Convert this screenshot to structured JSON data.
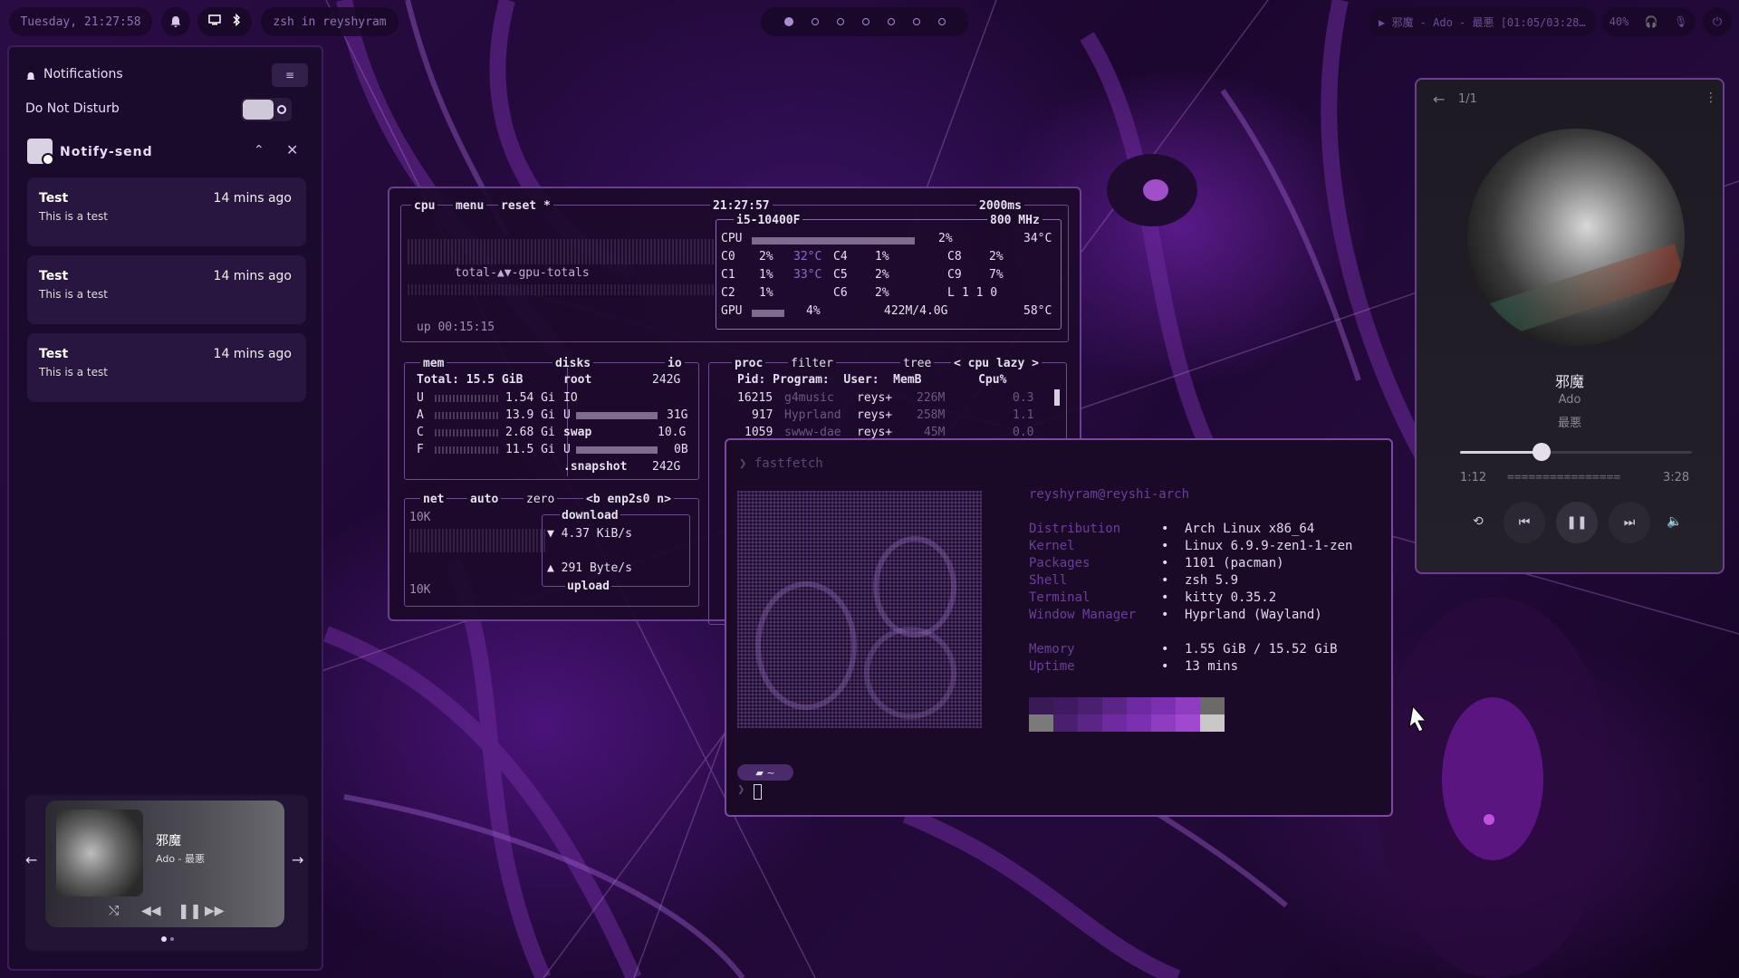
{
  "topbar": {
    "clock": "Tuesday, 21:27:58",
    "window_title": "zsh in reyshyram",
    "workspaces": [
      true,
      false,
      false,
      false,
      false,
      false,
      false
    ],
    "media_text": "▶ 邪魔 - Ado - 最悪 [01:05/03:28…",
    "volume": "40%"
  },
  "notifications": {
    "header": "Notifications",
    "dnd_label": "Do Not Disturb",
    "group_app": "Notify-send",
    "items": [
      {
        "title": "Test",
        "body": "This is a test",
        "time": "14 mins ago"
      },
      {
        "title": "Test",
        "body": "This is a test",
        "time": "14 mins ago"
      },
      {
        "title": "Test",
        "body": "This is a test",
        "time": "14 mins ago"
      }
    ],
    "mini_player": {
      "title": "邪魔",
      "artist": "Ado - 最悪"
    }
  },
  "btop": {
    "cpu_tabs": [
      "cpu",
      "menu",
      "reset *"
    ],
    "time": "21:27:57",
    "interval": "2000ms",
    "graph_label": "total-▲▼-gpu-totals",
    "uptime": "up 00:15:15",
    "cpu_name": "i5-10400F",
    "cpu_freq": "800 MHz",
    "cpu_rows": [
      {
        "l": "CPU",
        "p": "2%",
        "t": "34°C"
      },
      {
        "l": "C0",
        "p": "2%",
        "t": "32°C"
      },
      {
        "l": "C1",
        "p": "1%",
        "t": "33°C"
      },
      {
        "l": "C2",
        "p": "1%",
        "t": ""
      }
    ],
    "cpu_rows2": [
      {
        "l": "C4",
        "p": "1%"
      },
      {
        "l": "C5",
        "p": "2%"
      },
      {
        "l": "C6",
        "p": "2%"
      }
    ],
    "cpu_rows3": [
      {
        "l": "C8",
        "p": "2%"
      },
      {
        "l": "C9",
        "p": "7%"
      },
      {
        "l": "L",
        "p": "1 1 0"
      }
    ],
    "gpu": {
      "l": "GPU",
      "p": "4%",
      "mem": "422M/4.0G",
      "t": "58°C"
    },
    "mem": {
      "title": "mem",
      "total": "Total: 15.5 GiB",
      "rows": [
        {
          "l": "U",
          "v": "1.54 Gi"
        },
        {
          "l": "A",
          "v": "13.9 Gi"
        },
        {
          "l": "C",
          "v": "2.68 Gi"
        },
        {
          "l": "F",
          "v": "11.5 Gi"
        }
      ]
    },
    "disks": {
      "title": "disks",
      "io": "io",
      "root": "root",
      "root_size": "242G",
      "io_label": "IO",
      "u1": "31G",
      "swap": "swap",
      "swap_size": "10.G",
      "u2": "0B",
      "snap": ".snapshot",
      "snap_size": "242G"
    },
    "proc": {
      "tabs": [
        "proc",
        "filter",
        "tree",
        "< cpu lazy >"
      ],
      "headers": "Pid: Program:  User:  MemB        Cpu%",
      "rows": [
        {
          "pid": "16215",
          "prog": "g4music",
          "user": "reys+",
          "mem": "226M",
          "cpu": "0.3"
        },
        {
          "pid": "917",
          "prog": "Hyprland",
          "user": "reys+",
          "mem": "258M",
          "cpu": "1.1"
        },
        {
          "pid": "1059",
          "prog": "swww-dae",
          "user": "reys+",
          "mem": "45M",
          "cpu": "0.0"
        }
      ]
    },
    "net": {
      "tabs": [
        "net",
        "auto",
        "zero",
        "<b enp2s0 n>"
      ],
      "scale_top": "10K",
      "scale_bottom": "10K",
      "download_label": "download",
      "download": "▼ 4.37 KiB/s",
      "upload": "▲ 291 Byte/s",
      "upload_label": "upload"
    }
  },
  "fastfetch": {
    "command": "fastfetch",
    "user_host": "reyshyram@reyshi-arch",
    "info": [
      {
        "k": "Distribution",
        "v": "Arch Linux x86_64"
      },
      {
        "k": "Kernel",
        "v": "Linux 6.9.9-zen1-1-zen"
      },
      {
        "k": "Packages",
        "v": "1101 (pacman)"
      },
      {
        "k": "Shell",
        "v": "zsh 5.9"
      },
      {
        "k": "Terminal",
        "v": "kitty 0.35.2"
      },
      {
        "k": "Window Manager",
        "v": "Hyprland (Wayland)"
      }
    ],
    "info2": [
      {
        "k": "Memory",
        "v": "1.55 GiB / 15.52 GiB"
      },
      {
        "k": "Uptime",
        "v": "13 mins"
      }
    ],
    "palette_top": [
      "#3a1a55",
      "#3e1b60",
      "#4a1f70",
      "#5a2585",
      "#6e2aa0",
      "#7a30b0",
      "#8e3cc0",
      "#6a6a6a"
    ],
    "palette_bottom": [
      "#7a7a7a",
      "#4a1f70",
      "#5a2585",
      "#6e2aa0",
      "#7a30b0",
      "#8e3cc0",
      "#a048d0",
      "#c8c8c8"
    ],
    "prompt_dir": "~"
  },
  "music": {
    "queue": "1/1",
    "title": "邪魔",
    "artist": "Ado",
    "album": "最悪",
    "elapsed": "1:12",
    "total": "3:28",
    "eq": "================",
    "progress": 0.35
  }
}
